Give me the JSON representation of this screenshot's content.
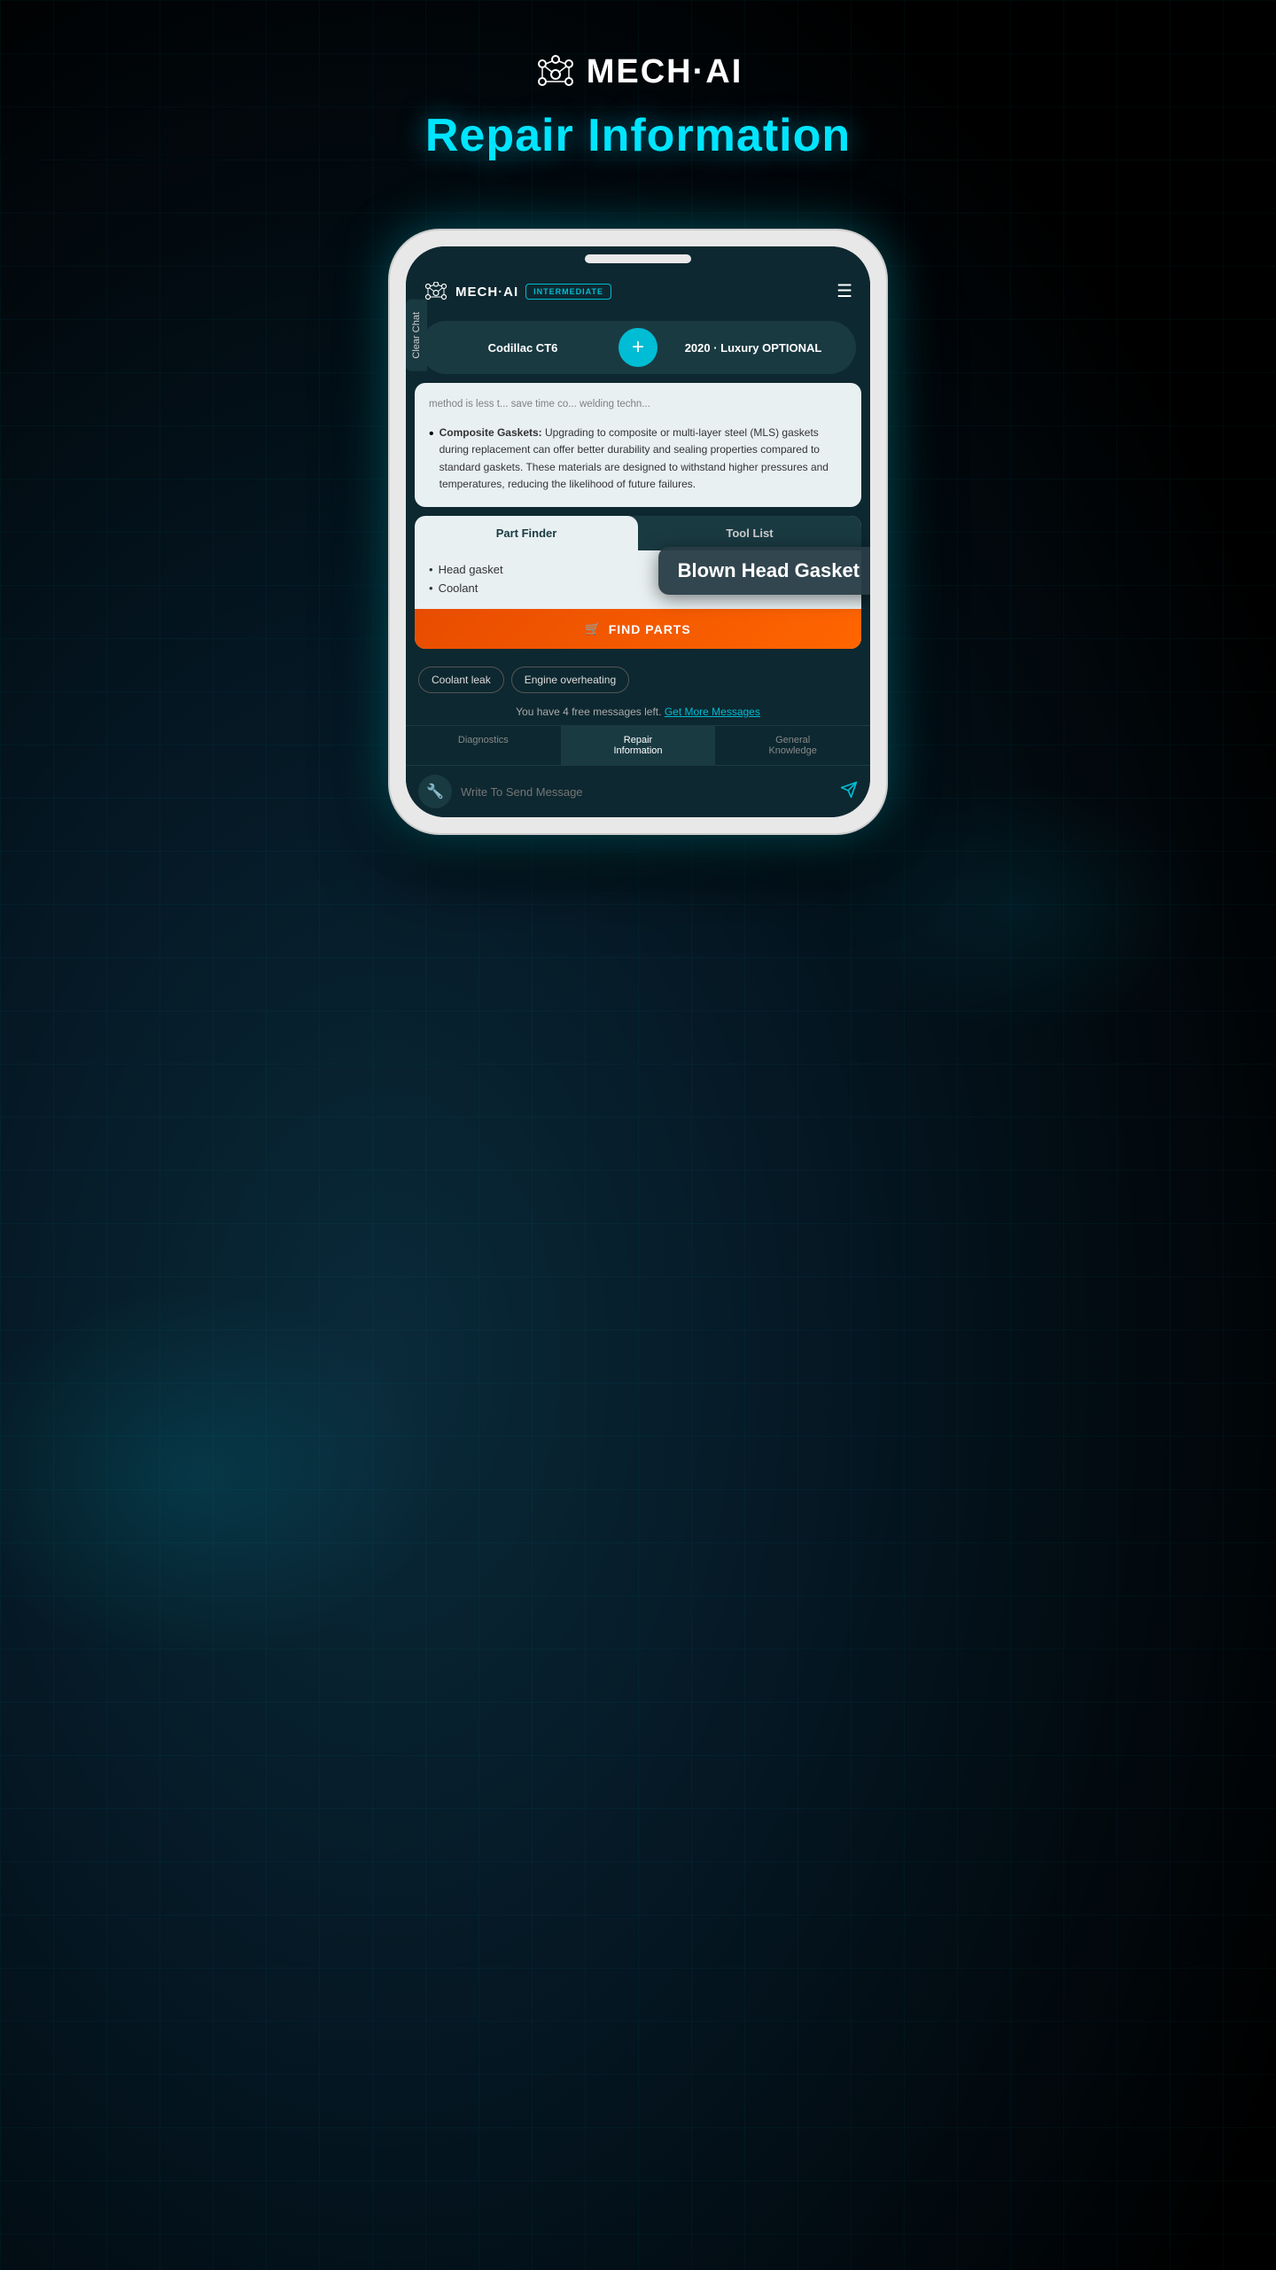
{
  "page": {
    "background": "#000",
    "logo_text": "MECH·AI",
    "page_title": "Repair Information"
  },
  "app": {
    "logo_text": "MECH·AI",
    "badge": "INTERMEDIATE",
    "vehicle": {
      "name": "Codillac CT6",
      "year_trim": "2020 · Luxury OPTIONAL"
    }
  },
  "tooltip": {
    "text": "Blown Head Gasket"
  },
  "clear_chat": "Clear Chat",
  "content": {
    "fade_text": "method is less t... save time co... welding techn...",
    "bullet_title": "Composite",
    "bullet_suffix": " Gaskets:",
    "bullet_body": " Upgrading to composite or multi-layer steel (MLS) gaskets during replacement can offer better durability and sealing properties compared to standard gaskets. These materials are designed to withstand higher pressures and temperatures, reducing the likelihood of future failures."
  },
  "part_finder": {
    "tab1": "Part Finder",
    "tab2": "Tool List",
    "items": [
      "Head gasket",
      "Coolant"
    ],
    "find_parts_label": "FIND PARTS"
  },
  "chips": [
    "Coolant leak",
    "Engine overheating"
  ],
  "messages_left": {
    "text": "You have 4 free messages left.",
    "link": "Get More Messages"
  },
  "bottom_nav": {
    "items": [
      "Diagnostics",
      "Repair\nInformation",
      "General\nKnowledge"
    ]
  },
  "input": {
    "placeholder": "Write To Send Message"
  }
}
